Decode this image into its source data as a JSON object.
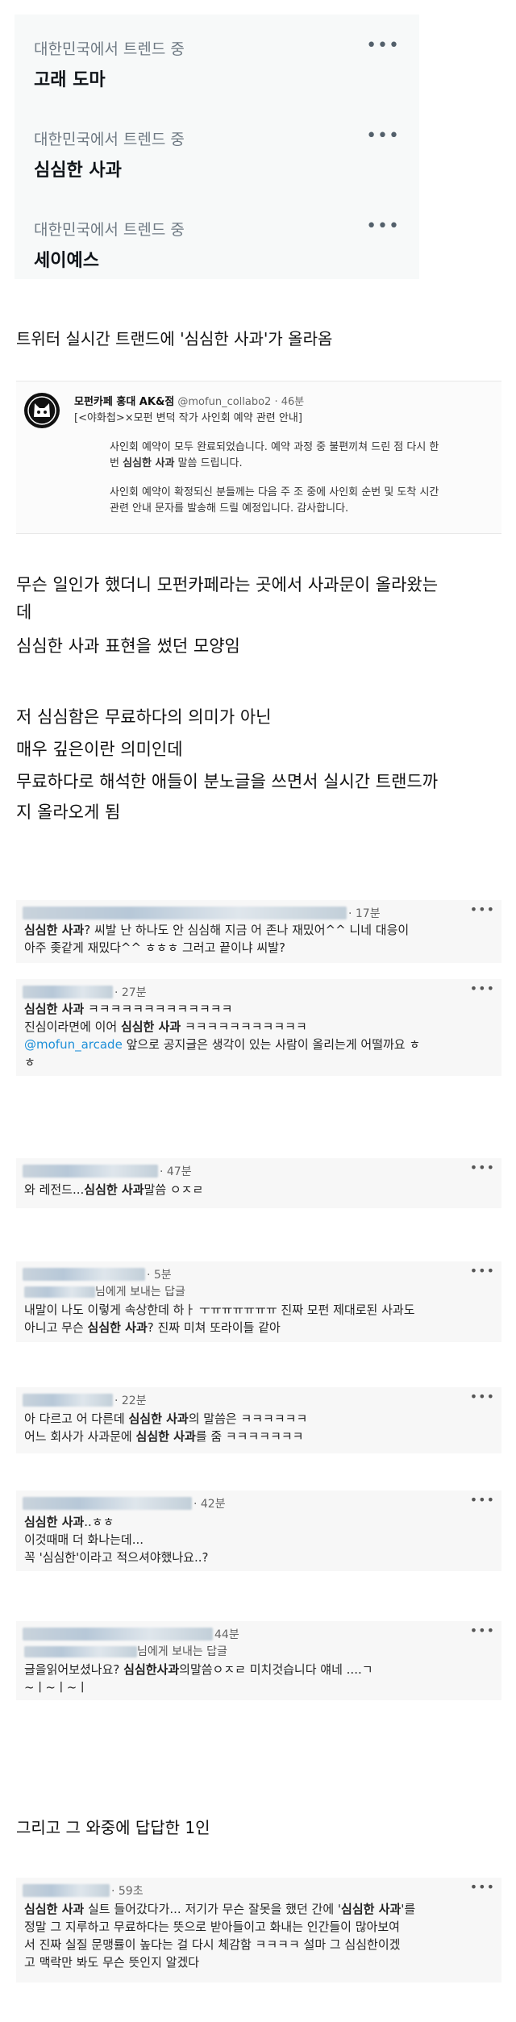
{
  "trends": [
    {
      "context": "대한민국에서 트렌드 중",
      "name": "고래 도마"
    },
    {
      "context": "대한민국에서 트렌드 중",
      "name": "심심한 사과"
    },
    {
      "context": "대한민국에서 트렌드 중",
      "name": "세이예스"
    }
  ],
  "more_glyph": "•••",
  "caption1": "트위터 실시간 트랜드에 '심심한 사과'가 올라옴",
  "notice": {
    "account": "모펀카페 홍대 AK&점",
    "handle_time": "@mofun_collabo2 · 46분",
    "title": "[<야화첩>×모펀 변덕 작가 사인회 예약 관련 안내]",
    "para1_line1": "사인회 예약이 모두 완료되었습니다. 예약 과정 중 불편끼쳐 드린 점 다시 한",
    "para1_pre": "번 ",
    "para1_bold": "심심한 사과",
    "para1_post": " 말씀 드립니다.",
    "para2_line1": "사인회 예약이 확정되신 분들께는 다음 주 조 중에 사인회 순번 및 도착 시간",
    "para2_line2": "관련 안내 문자를 발송해 드릴 예정입니다. 감사합니다."
  },
  "explain": {
    "l1": "무슨 일인가 했더니 모펀카페라는 곳에서 사과문이 올라왔는",
    "l2": "데",
    "l3": "심심한 사과 표현을 썼던 모양임",
    "l4": "저 심심함은 무료하다의 의미가 아닌",
    "l5": "매우 깊은이란 의미인데",
    "l6": "무료하다로 해석한 애들이 분노글을 쓰면서 실시간 트랜드까",
    "l7": "지 올라오게 됨"
  },
  "comments": [
    {
      "time": "· 17분",
      "l1_bold": "심심한 사과",
      "l1": "? 씨발 난 하나도 안 심심해 지금 어 존나 재밌어^^ 니네 대응이",
      "l2": "아주 좆같게 재밌다^^ ㅎㅎㅎ 그러고 끝이냐 씨발?"
    },
    {
      "time": "· 27분",
      "l1_bold": "심심한 사과",
      "l1": " ㅋㅋㅋㅋㅋㅋㅋㅋㅋㅋㅋㅋㅋ",
      "l2_pre": "진심이라면에 이어 ",
      "l2_bold": "심심한 사과",
      "l2_post": " ㅋㅋㅋㅋㅋㅋㅋㅋㅋㅋㅋ",
      "l3_mention": "@mofun_arcade",
      "l3": " 앞으로 공지글은 생각이 있는 사람이 올리는게 어떨까요 ㅎ",
      "l4": "ㅎ"
    },
    {
      "time": "· 47분",
      "l1_pre": "와 레전드...",
      "l1_bold": "심심한 사과",
      "l1_post": "말씀 ㅇㅈㄹ"
    },
    {
      "time": "· 5분",
      "reply": "님에게 보내는 답글",
      "l1": "내말이 나도 이렇게 속상한데 하ㅏ ㅜㅠㅠㅠㅠㅠㅠ 진짜 모펀 제대로된 사과도",
      "l2_pre": "아니고 무슨 ",
      "l2_bold": "심심한 사과",
      "l2_post": "? 진짜 미쳐 또라이들 같아"
    },
    {
      "time": "· 22분",
      "l1_pre": "아 다르고 어 다른데 ",
      "l1_bold": "심심한 사과",
      "l1_post": "의 말씀은 ㅋㅋㅋㅋㅋㅋ",
      "l2_pre": "어느 회사가 사과문에 ",
      "l2_bold": "심심한 사과",
      "l2_post": "를 줌 ㅋㅋㅋㅋㅋㅋㅋ"
    },
    {
      "time": "· 42분",
      "l1_bold": "심심한 사과",
      "l1": "..ㅎㅎ",
      "l2": "이것때매 더 화나는데...",
      "l3": "꼭 '심심한'이라고 적으셔야했나요..?"
    },
    {
      "time": "44분",
      "reply": "님에게 보내는 답글",
      "l1_pre": "글을읽어보셨나요? ",
      "l1_bold": "심심한사과",
      "l1_post": "의말씀ㅇㅈㄹ 미치것습니다 얘네 ....ㄱ",
      "l2": "~ㅣ~ㅣ~ㅣ"
    },
    {
      "time": "· 59초",
      "l1_bold1": "심심한 사과",
      "l1_mid": " 실트 들어갔다가... 저기가 무슨 잘못을 했던 간에 '",
      "l1_bold2": "심심한 사과",
      "l1_post": "'를",
      "l2": "정말 그 지루하고 무료하다는 뜻으로 받아들이고 화내는 인간들이 많아보여",
      "l3": "서 진짜 실질 문맹률이 높다는 걸 다시 체감함 ㅋㅋㅋㅋ 설마 그 심심한이겠",
      "l4": "고 맥락만 봐도 무슨 뜻인지 알겠다"
    }
  ],
  "caption2": "그리고 그 와중에 답답한 1인"
}
